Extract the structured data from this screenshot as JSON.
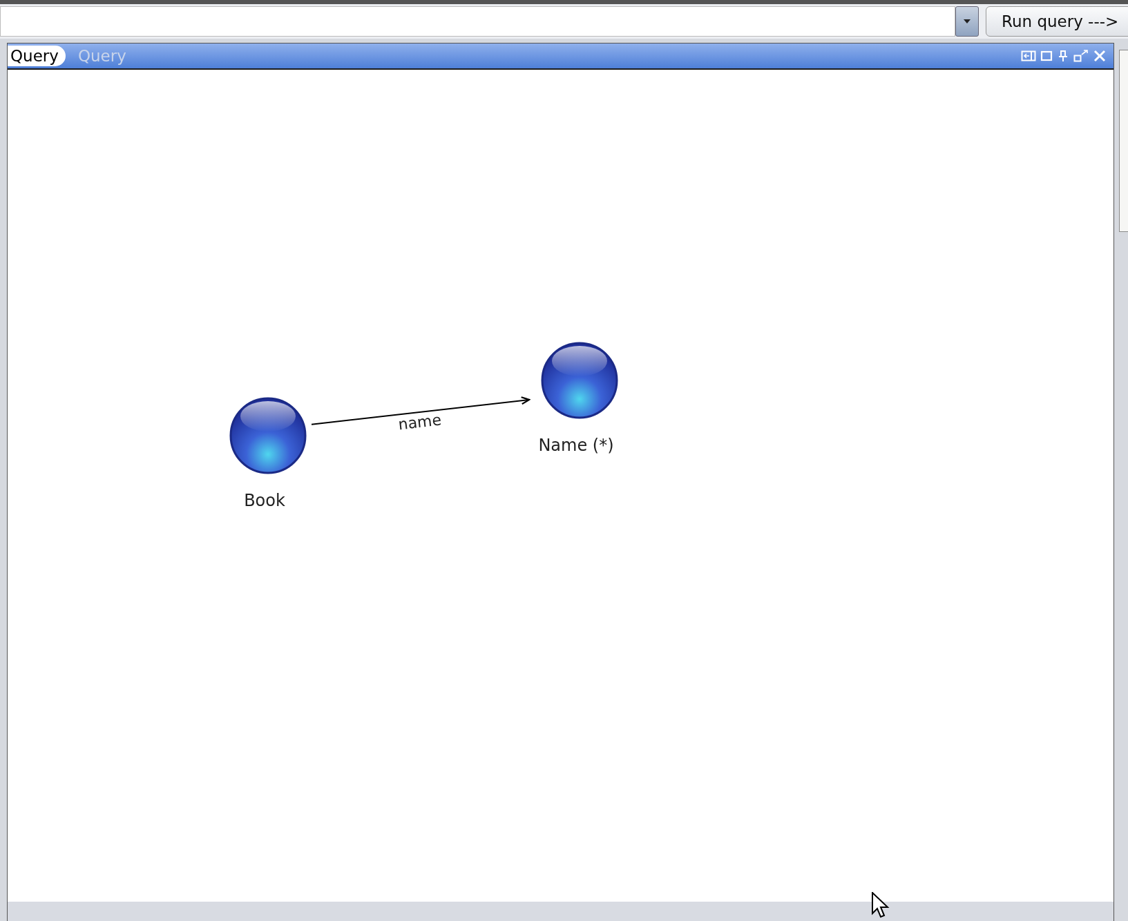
{
  "toolbar": {
    "run_button": "Run query --->"
  },
  "panel": {
    "tabs": [
      {
        "label": "Query",
        "selected": true
      },
      {
        "label": "Query",
        "selected": false
      }
    ]
  },
  "graph": {
    "nodes": [
      {
        "label": "Book"
      },
      {
        "label": "Name (*)"
      }
    ],
    "edges": [
      {
        "label": "name"
      }
    ]
  }
}
